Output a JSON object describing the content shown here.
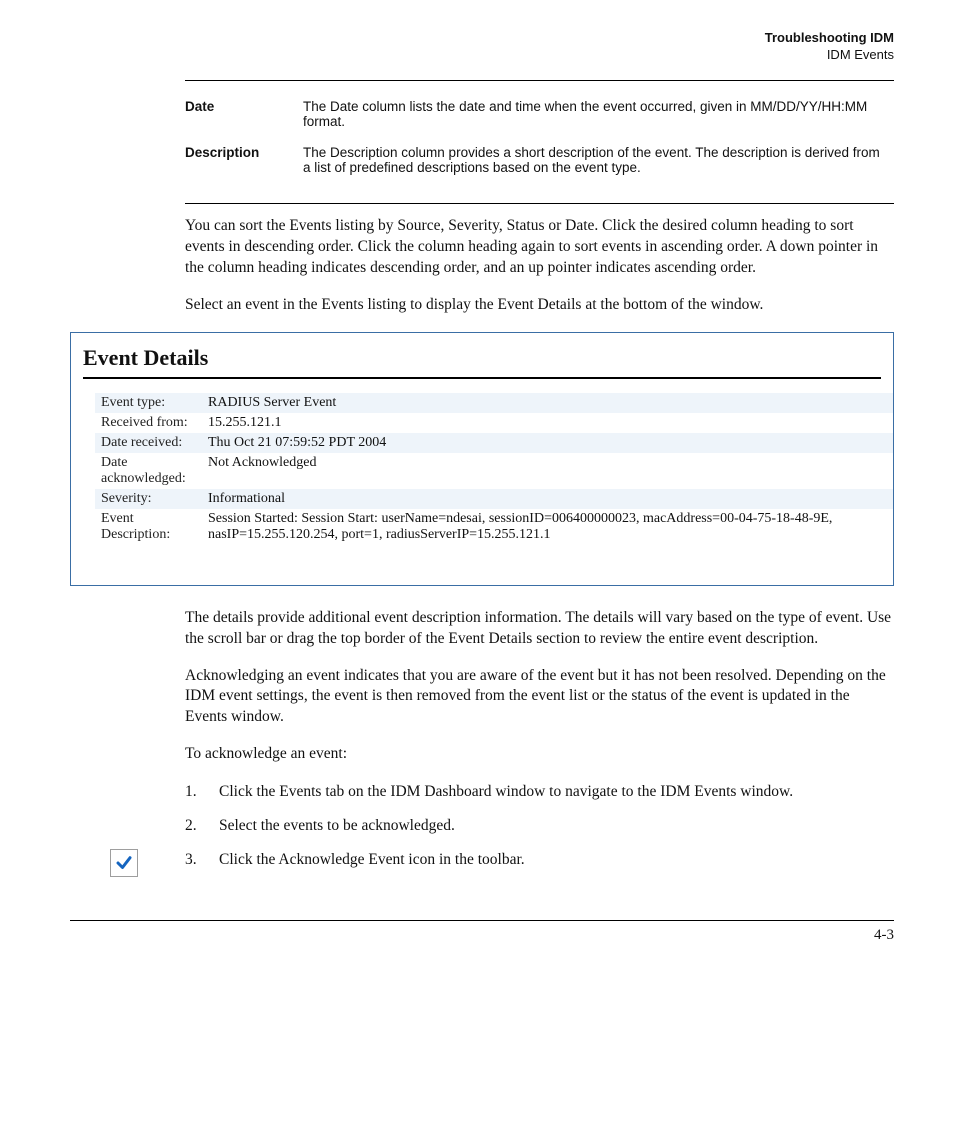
{
  "header": {
    "title": "Troubleshooting IDM",
    "subtitle": "IDM Events"
  },
  "definitions": [
    {
      "term": "Date",
      "desc": "The Date column lists the date and time when the event occurred, given in MM/DD/YY/HH:MM format."
    },
    {
      "term": "Description",
      "desc": "The Description column provides a short description of the event. The description is derived from a list of predefined descriptions based on the event type."
    }
  ],
  "para1": "You can sort the Events listing by Source, Severity, Status or Date. Click the desired column heading to sort events in descending order. Click the column heading again to sort events in ascending order. A down pointer in the column heading indicates descending order, and an up pointer indicates ascending order.",
  "para2": "Select an event in the Events listing to display the Event Details at the bottom of the window.",
  "eventDetails": {
    "title": "Event Details",
    "rows": [
      {
        "label": "Event type:",
        "value": "RADIUS Server Event",
        "band": true
      },
      {
        "label": "Received from:",
        "value": "15.255.121.1",
        "band": false
      },
      {
        "label": "Date received:",
        "value": "Thu Oct 21 07:59:52 PDT 2004",
        "band": true
      },
      {
        "label": "Date acknowledged:",
        "value": "Not Acknowledged",
        "band": false
      },
      {
        "label": "Severity:",
        "value": "Informational",
        "band": true
      },
      {
        "label": "Event Description:",
        "value": "Session Started: Session Start: userName=ndesai, sessionID=006400000023, macAddress=00-04-75-18-48-9E, nasIP=15.255.120.254, port=1, radiusServerIP=15.255.121.1",
        "band": false
      }
    ]
  },
  "para3": "The details provide additional event description information. The details will vary based on the type of event. Use the scroll bar or drag the top border of the Event Details section to review the entire event description.",
  "para4": "Acknowledging an event indicates that you are aware of the event but it has not been resolved. Depending on the IDM event settings, the event is then removed from the event list or the status of the event is updated in the Events window.",
  "para5": "To acknowledge an event:",
  "steps": [
    "Click the Events tab on the IDM Dashboard window to navigate to the IDM Events window.",
    "Select the events to be acknowledged.",
    "Click the Acknowledge Event icon in the toolbar."
  ],
  "pageNumber": "4-3"
}
